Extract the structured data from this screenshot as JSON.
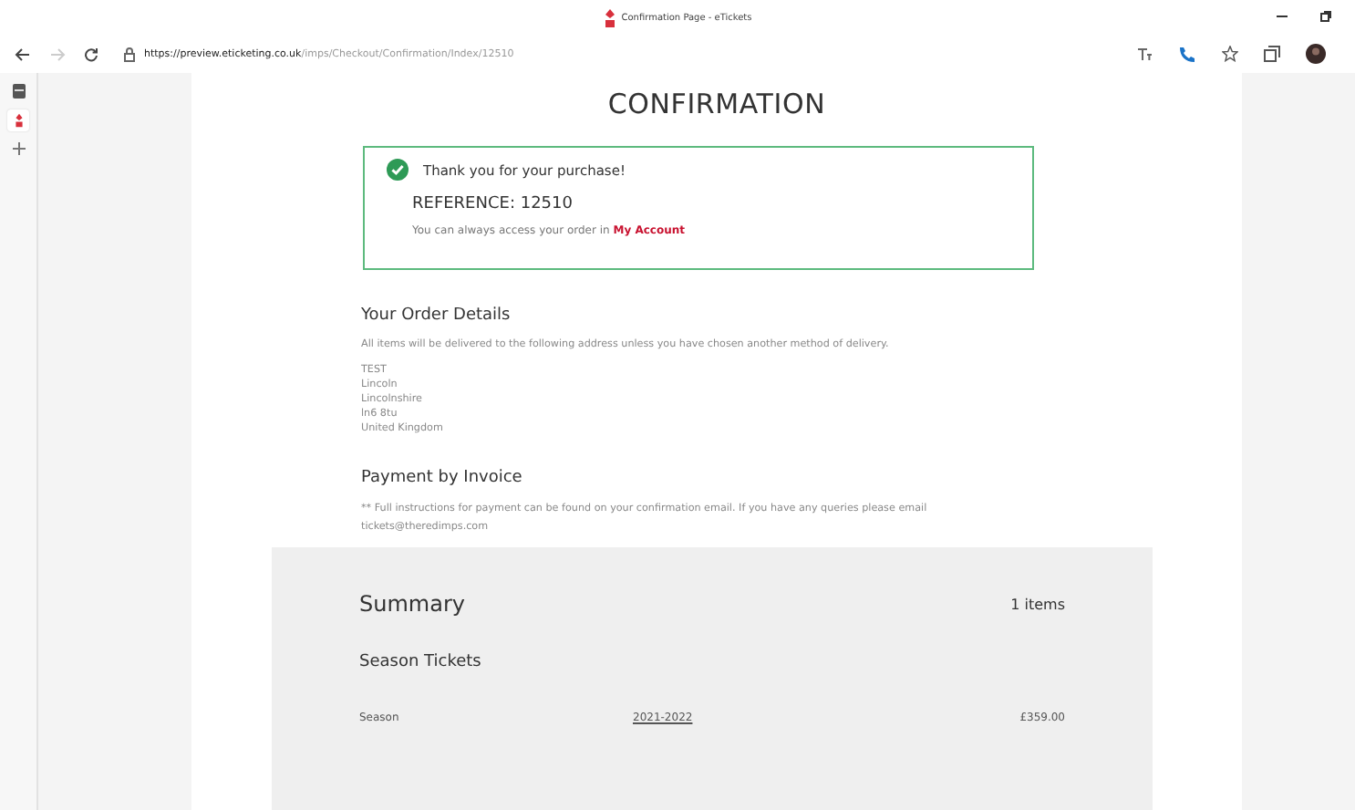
{
  "browser": {
    "tab_title": "Confirmation Page - eTickets",
    "url_host": "https://preview.eticketing.co.uk",
    "url_path": "/imps/Checkout/Confirmation/Index/12510"
  },
  "page": {
    "title": "CONFIRMATION",
    "confirmation": {
      "message": "Thank you for your purchase!",
      "reference": "REFERENCE: 12510",
      "note": "You can always access your order in ",
      "link": "My Account"
    },
    "order_details": {
      "heading": "Your Order Details",
      "intro": "All items will be delivered to the following address unless you have chosen another method of delivery.",
      "address": [
        "TEST",
        "Lincoln",
        "Lincolnshire",
        "ln6 8tu",
        "United Kingdom"
      ]
    },
    "payment": {
      "heading": "Payment by Invoice",
      "text": "** Full instructions for payment can be found on your confirmation email. If you have any queries please email tickets@theredimps.com"
    },
    "summary": {
      "heading": "Summary",
      "count": "1 items",
      "group": "Season Tickets",
      "rows": [
        {
          "name": "Season",
          "period": "2021-2022",
          "price": "£359.00"
        }
      ]
    }
  }
}
